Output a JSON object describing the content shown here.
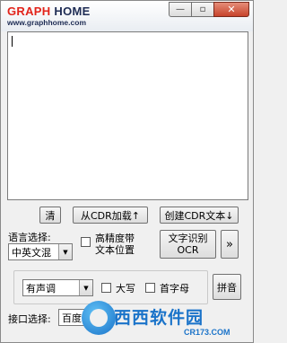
{
  "window": {
    "logo": {
      "part1": "GRAPH",
      "part2": "HOME",
      "sub": "www.graphhome.com"
    },
    "controls": {
      "minimize": "—",
      "maximize": "▫",
      "close": "✕"
    }
  },
  "editor": {
    "value": ""
  },
  "buttons": {
    "clear": "清",
    "load_cdr": "从CDR加载↑",
    "create_cdr": "创建CDR文本↓",
    "ocr_line1": "文字识别",
    "ocr_line2": "OCR",
    "more": "»",
    "pinyin": "拼音"
  },
  "language": {
    "label": "语言选择:",
    "selected": "中英文混"
  },
  "high_precision": {
    "line1": "高精度带",
    "line2": "文本位置",
    "checked": false
  },
  "tone": {
    "selected": "有声调"
  },
  "uppercase": {
    "label": "大写",
    "checked": false
  },
  "initials": {
    "label": "首字母",
    "checked": false
  },
  "interface": {
    "label": "接口选择:",
    "selected": "百度"
  },
  "watermark": {
    "text": "西西软件园",
    "url": "CR173.COM"
  }
}
